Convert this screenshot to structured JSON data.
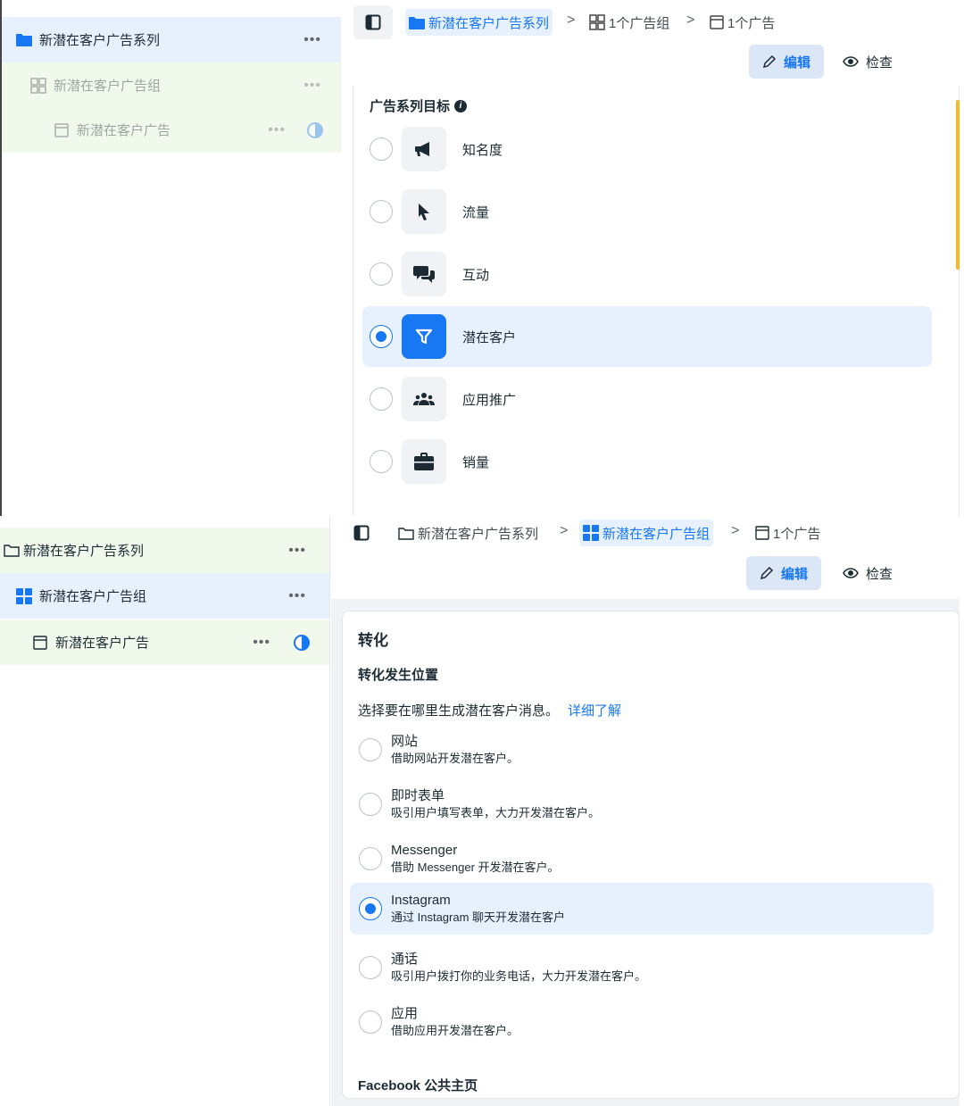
{
  "panel1": {
    "sidebar": {
      "campaign": {
        "label": "新潜在客户广告系列",
        "more": "•••"
      },
      "adset": {
        "label": "新潜在客户广告组",
        "more": "•••"
      },
      "ad": {
        "label": "新潜在客户广告",
        "more": "•••"
      }
    },
    "breadcrumb": {
      "campaign": "新潜在客户广告系列",
      "adset": "1个广告组",
      "ad": "1个广告",
      "separator": ">"
    },
    "toolbar": {
      "edit_label": "编辑",
      "inspect_label": "检查"
    },
    "objective": {
      "heading": "广告系列目标",
      "options": [
        {
          "label": "知名度",
          "icon": "megaphone-icon",
          "selected": false
        },
        {
          "label": "流量",
          "icon": "cursor-icon",
          "selected": false
        },
        {
          "label": "互动",
          "icon": "chat-bubbles-icon",
          "selected": false
        },
        {
          "label": "潜在客户",
          "icon": "filter-icon",
          "selected": true
        },
        {
          "label": "应用推广",
          "icon": "people-icon",
          "selected": false
        },
        {
          "label": "销量",
          "icon": "briefcase-icon",
          "selected": false
        }
      ]
    }
  },
  "panel2": {
    "sidebar": {
      "campaign": {
        "label": "新潜在客户广告系列",
        "more": "•••"
      },
      "adset": {
        "label": "新潜在客户广告组",
        "more": "•••"
      },
      "ad": {
        "label": "新潜在客户广告",
        "more": "•••"
      }
    },
    "breadcrumb": {
      "campaign": "新潜在客户广告系列",
      "adset": "新潜在客户广告组",
      "ad": "1个广告",
      "separator": ">"
    },
    "toolbar": {
      "edit_label": "编辑",
      "inspect_label": "检查"
    },
    "conversion": {
      "heading": "转化",
      "location_heading": "转化发生位置",
      "prompt": "选择要在哪里生成潜在客户消息。",
      "learn_more": "详细了解",
      "options": [
        {
          "title": "网站",
          "desc": "借助网站开发潜在客户。",
          "selected": false
        },
        {
          "title": "即时表单",
          "desc": "吸引用户填写表单，大力开发潜在客户。",
          "selected": false
        },
        {
          "title": "Messenger",
          "desc": "借助 Messenger 开发潜在客户。",
          "selected": false
        },
        {
          "title": "Instagram",
          "desc": "通过 Instagram 聊天开发潜在客户",
          "selected": true
        },
        {
          "title": "通话",
          "desc": "吸引用户拨打你的业务电话，大力开发潜在客户。",
          "selected": false
        },
        {
          "title": "应用",
          "desc": "借助应用开发潜在客户。",
          "selected": false
        }
      ],
      "page_heading": "Facebook 公共主页"
    }
  },
  "colors": {
    "accent": "#1877f2",
    "selected_bg": "#e7f0fd",
    "tree_active": "#e7f0fd",
    "tree_sub": "#f1f9ec"
  }
}
